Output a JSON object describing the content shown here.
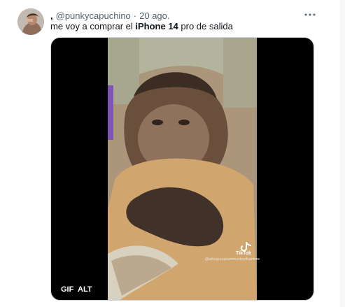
{
  "tweet": {
    "display_name": ",",
    "handle": "@punkycapuchino",
    "separator": "·",
    "date": "20 ago.",
    "text_before": "me voy a comprar el ",
    "text_bold": "iPhone 14",
    "text_after": " pro de salida"
  },
  "media": {
    "gif_badge": "GIF",
    "alt_badge": "ALT",
    "watermark_brand": "TikTok",
    "watermark_user": "@whosyourpeachmonkey4rainbow"
  },
  "colors": {
    "secondary_text": "#536471",
    "primary_text": "#0f1419",
    "media_background": "#000000"
  }
}
